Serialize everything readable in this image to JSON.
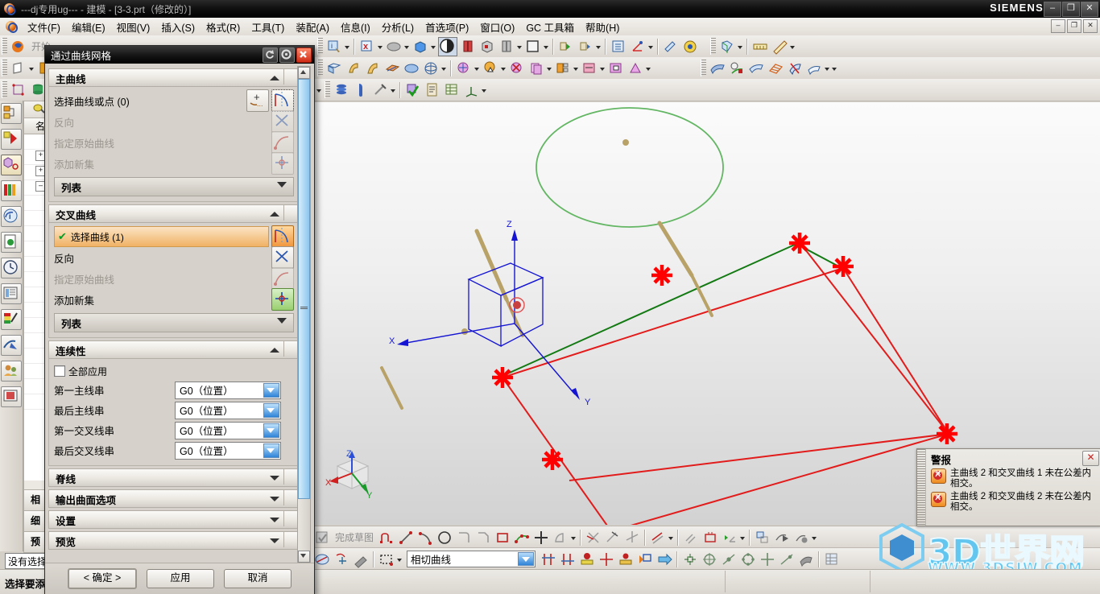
{
  "titlebar": {
    "text": "---dj专用ug--- - 建模 - [3-3.prt（修改的）]",
    "brand": "SIEMENS",
    "minimize": "–",
    "restore": "❐",
    "close": "✕"
  },
  "menubar": {
    "items": [
      {
        "label": "文件(F)"
      },
      {
        "label": "编辑(E)"
      },
      {
        "label": "视图(V)"
      },
      {
        "label": "插入(S)"
      },
      {
        "label": "格式(R)"
      },
      {
        "label": "工具(T)"
      },
      {
        "label": "装配(A)"
      },
      {
        "label": "信息(I)"
      },
      {
        "label": "分析(L)"
      },
      {
        "label": "首选项(P)"
      },
      {
        "label": "窗口(O)"
      },
      {
        "label": "GC 工具箱"
      },
      {
        "label": "帮助(H)"
      }
    ],
    "minimize": "–",
    "restore": "❐",
    "close": "✕"
  },
  "toolbar": {
    "start_label": "开始",
    "finish_sketch_label": "完成草图",
    "curve_rule": {
      "value": "相切曲线"
    }
  },
  "navigator": {
    "tab_label": "名",
    "sections": [
      {
        "label": "相"
      },
      {
        "label": "细"
      },
      {
        "label": "预"
      }
    ]
  },
  "dialog": {
    "title": "通过曲线网格",
    "titlebar_buttons": {
      "reset": "↺",
      "settings": "⚙",
      "close": "✕"
    },
    "groups": [
      {
        "id": "primary_curves",
        "title": "主曲线",
        "collapsed": false,
        "rows": [
          {
            "label": "选择曲线或点 (0)",
            "disabled": false,
            "selected": false,
            "icons": [
              "add-point-icon",
              "select-curve-icon"
            ]
          },
          {
            "label": "反向",
            "disabled": true,
            "icons": [
              "reverse-direction-icon"
            ]
          },
          {
            "label": "指定原始曲线",
            "disabled": true,
            "icons": [
              "specify-original-curve-icon"
            ]
          },
          {
            "label": "添加新集",
            "disabled": true,
            "icons": [
              "add-new-set-icon"
            ]
          }
        ],
        "list_label": "列表"
      },
      {
        "id": "cross_curves",
        "title": "交叉曲线",
        "collapsed": false,
        "rows": [
          {
            "label": "选择曲线 (1)",
            "disabled": false,
            "selected": true,
            "icons": [
              "select-curve-icon"
            ]
          },
          {
            "label": "反向",
            "disabled": false,
            "icons": [
              "reverse-direction-icon"
            ]
          },
          {
            "label": "指定原始曲线",
            "disabled": true,
            "icons": [
              "specify-original-curve-icon"
            ]
          },
          {
            "label": "添加新集",
            "disabled": false,
            "icons": [
              "add-new-set-icon"
            ]
          }
        ],
        "list_label": "列表"
      }
    ],
    "continuity": {
      "title": "连续性",
      "apply_all_label": "全部应用",
      "apply_all_checked": false,
      "rows": [
        {
          "label": "第一主线串",
          "value": "G0（位置）"
        },
        {
          "label": "最后主线串",
          "value": "G0（位置）"
        },
        {
          "label": "第一交叉线串",
          "value": "G0（位置）"
        },
        {
          "label": "最后交叉线串",
          "value": "G0（位置）"
        }
      ]
    },
    "collapsed_groups": [
      {
        "title": "脊线"
      },
      {
        "title": "输出曲面选项"
      },
      {
        "title": "设置"
      },
      {
        "title": "预览"
      }
    ],
    "buttons": {
      "ok": "< 确定 >",
      "apply": "应用",
      "cancel": "取消"
    }
  },
  "alert": {
    "title": "警报",
    "close": "✕",
    "messages": [
      "主曲线 2 和交叉曲线 1 未在公差内相交。",
      "主曲线 2 和交叉曲线 2 未在公差内相交。"
    ]
  },
  "statusbar": {
    "cue_value": "没有选择对象",
    "prompt": "选择要添加的曲线"
  },
  "viewport": {
    "axes": {
      "x": "X",
      "y": "Y",
      "z": "Z"
    },
    "triad": {
      "x": "X",
      "y": "Y",
      "z": "Z"
    },
    "colors": {
      "primary_curve": "#e21b1b",
      "cross_curve": "#1a8a1a",
      "circle": "#63b663",
      "wcs": "#1414d2",
      "arrow": "#b9a268",
      "star": "#ff0000"
    }
  },
  "watermark": {
    "main": "3D世界网",
    "sub": "WWW.3DSJW.COM"
  }
}
